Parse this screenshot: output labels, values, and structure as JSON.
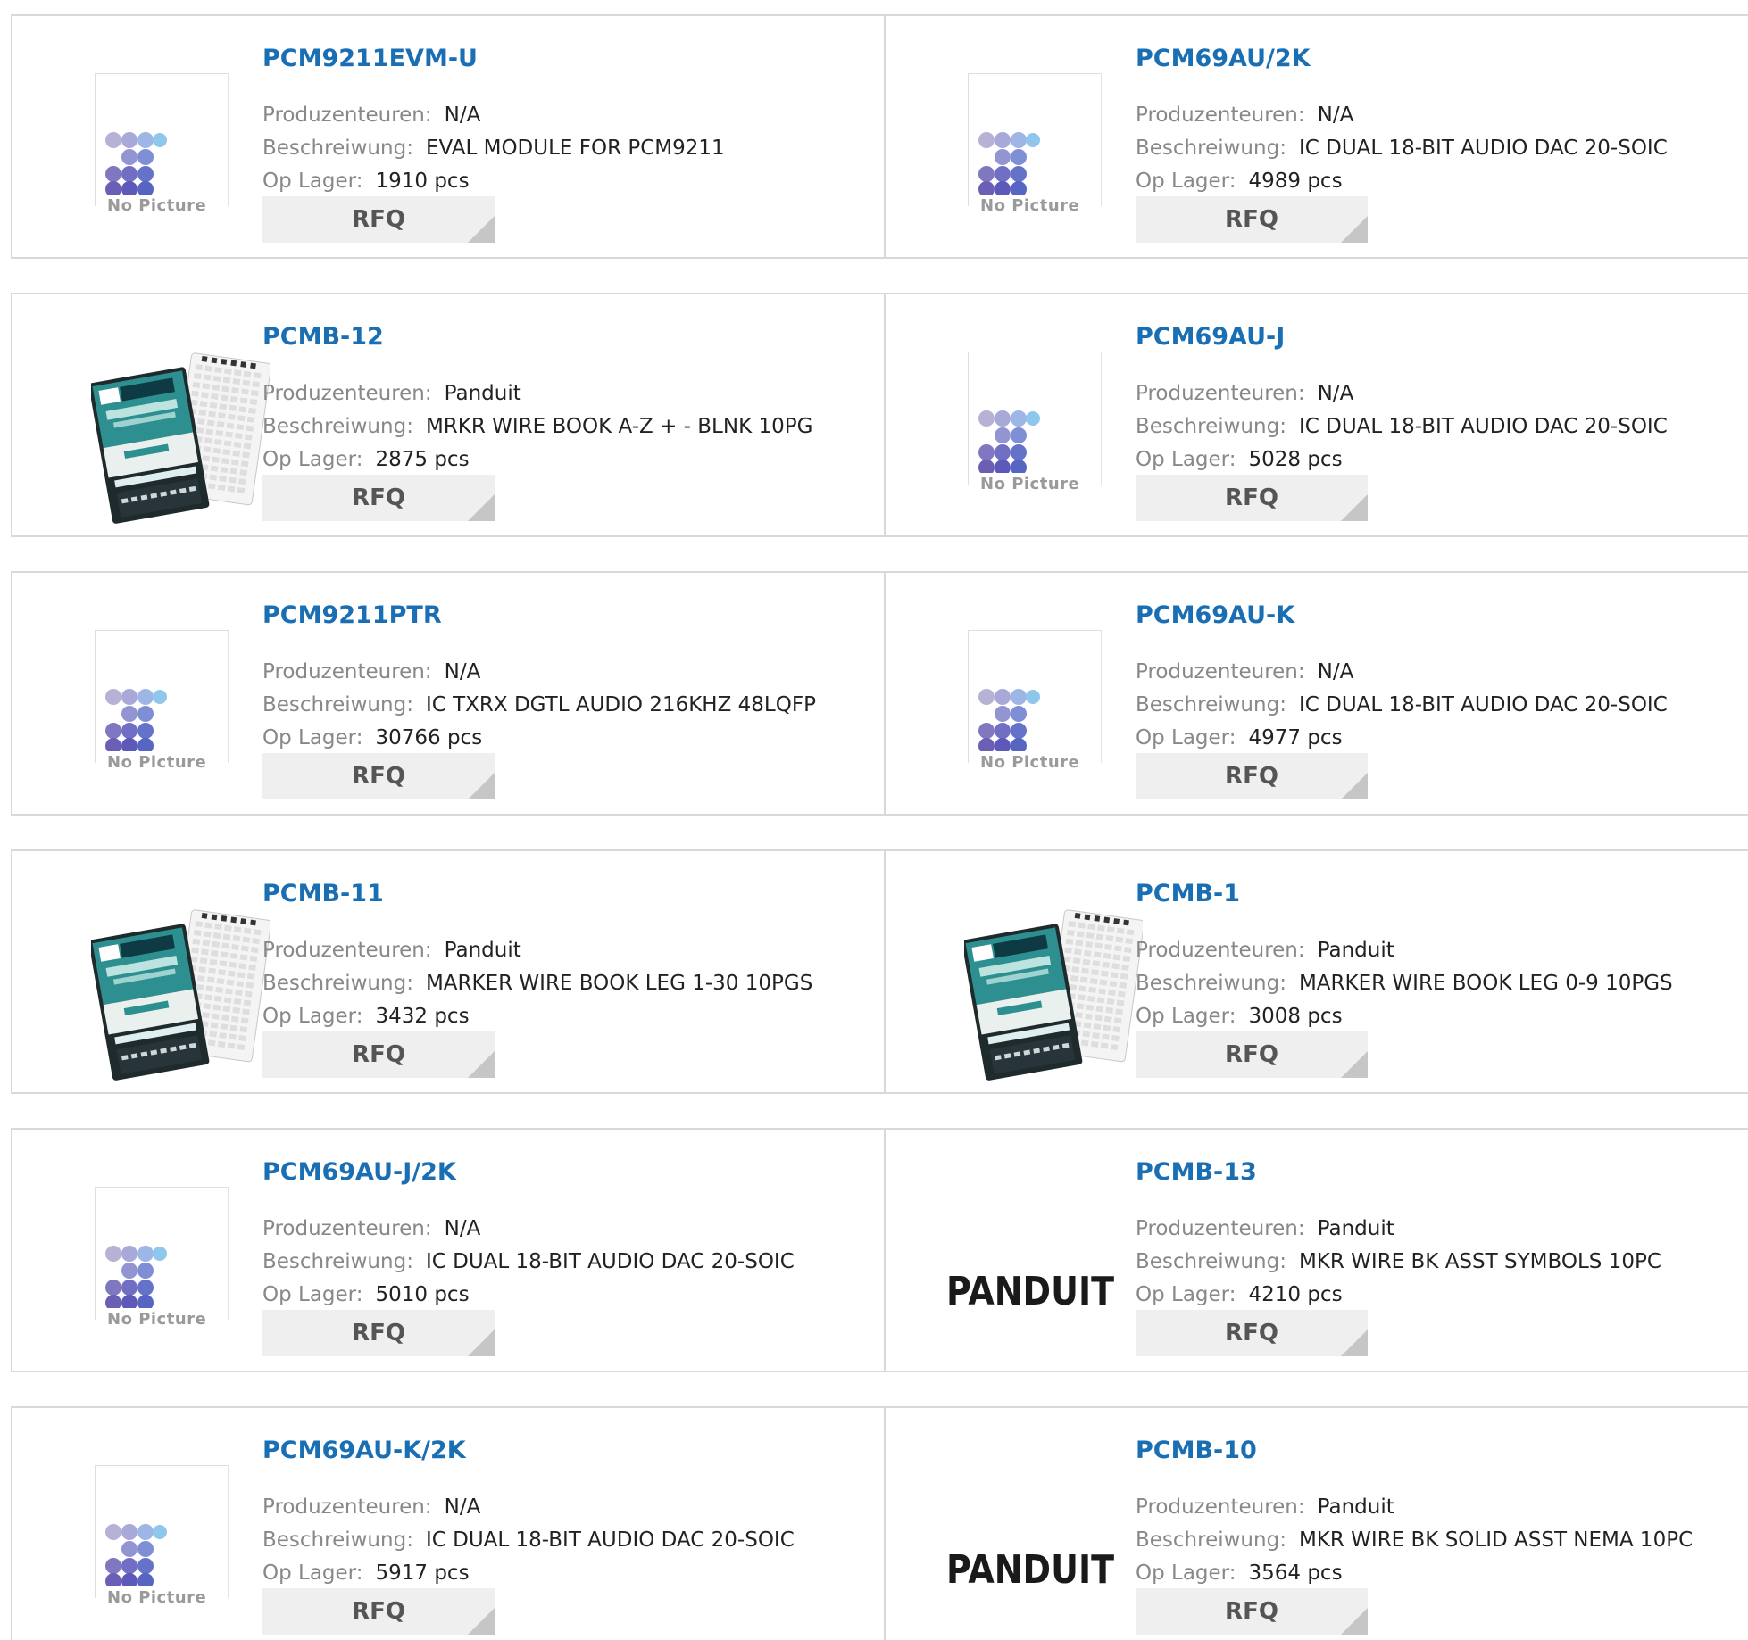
{
  "labels": {
    "manufacturer": "Produzenteuren:",
    "description": "Beschreiwung:",
    "stock": "Op Lager:",
    "rfq": "RFQ",
    "no_picture": "No Picture",
    "logo": "PANDUIT"
  },
  "products": [
    {
      "part": "PCM9211EVM-U",
      "manufacturer": "N/A",
      "description": "EVAL MODULE FOR PCM9211",
      "stock": "1910 pcs",
      "image": "no-picture"
    },
    {
      "part": "PCM69AU/2K",
      "manufacturer": "N/A",
      "description": "IC DUAL 18-BIT AUDIO DAC 20-SOIC",
      "stock": "4989 pcs",
      "image": "no-picture"
    },
    {
      "part": "PCMB-12",
      "manufacturer": "Panduit",
      "description": "MRKR WIRE BOOK A-Z + - BLNK 10PG",
      "stock": "2875 pcs",
      "image": "marker-book"
    },
    {
      "part": "PCM69AU-J",
      "manufacturer": "N/A",
      "description": "IC DUAL 18-BIT AUDIO DAC 20-SOIC",
      "stock": "5028 pcs",
      "image": "no-picture"
    },
    {
      "part": "PCM9211PTR",
      "manufacturer": "N/A",
      "description": "IC TXRX DGTL AUDIO 216KHZ 48LQFP",
      "stock": "30766 pcs",
      "image": "no-picture"
    },
    {
      "part": "PCM69AU-K",
      "manufacturer": "N/A",
      "description": "IC DUAL 18-BIT AUDIO DAC 20-SOIC",
      "stock": "4977 pcs",
      "image": "no-picture"
    },
    {
      "part": "PCMB-11",
      "manufacturer": "Panduit",
      "description": "MARKER WIRE BOOK LEG 1-30 10PGS",
      "stock": "3432 pcs",
      "image": "marker-book"
    },
    {
      "part": "PCMB-1",
      "manufacturer": "Panduit",
      "description": "MARKER WIRE BOOK LEG 0-9 10PGS",
      "stock": "3008 pcs",
      "image": "marker-book"
    },
    {
      "part": "PCM69AU-J/2K",
      "manufacturer": "N/A",
      "description": "IC DUAL 18-BIT AUDIO DAC 20-SOIC",
      "stock": "5010 pcs",
      "image": "no-picture"
    },
    {
      "part": "PCMB-13",
      "manufacturer": "Panduit",
      "description": "MKR WIRE BK ASST SYMBOLS 10PC",
      "stock": "4210 pcs",
      "image": "panduit-logo"
    },
    {
      "part": "PCM69AU-K/2K",
      "manufacturer": "N/A",
      "description": "IC DUAL 18-BIT AUDIO DAC 20-SOIC",
      "stock": "5917 pcs",
      "image": "no-picture"
    },
    {
      "part": "PCMB-10",
      "manufacturer": "Panduit",
      "description": "MKR WIRE BK SOLID ASST NEMA 10PC",
      "stock": "3564 pcs",
      "image": "panduit-logo"
    }
  ],
  "colors": {
    "link": "#1a6fb4",
    "label": "#888888",
    "value": "#222222",
    "rfq_bg": "#efefef",
    "border": "#d9d9d9"
  }
}
